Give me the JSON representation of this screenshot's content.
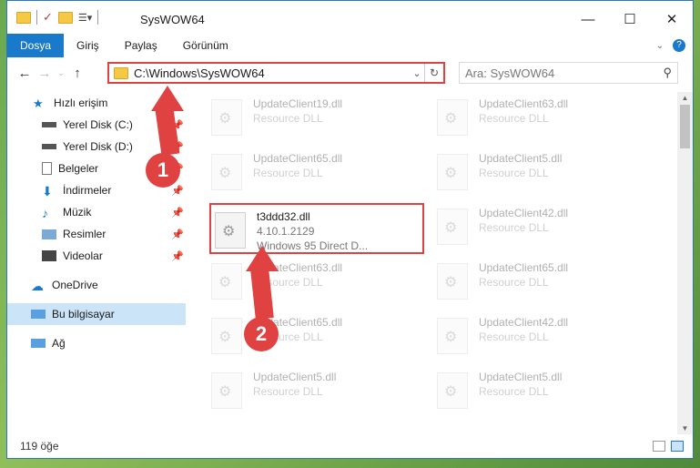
{
  "window": {
    "title": "SysWOW64"
  },
  "ribbon": {
    "tabs": [
      "Dosya",
      "Giriş",
      "Paylaş",
      "Görünüm"
    ],
    "help": "?"
  },
  "address": {
    "path": "C:\\Windows\\SysWOW64",
    "search_placeholder": "Ara: SysWOW64"
  },
  "nav": {
    "items": [
      {
        "label": "Hızlı erişim",
        "icon": "star-icon",
        "pinned": false
      },
      {
        "label": "Yerel Disk (C:)",
        "icon": "drive-icon",
        "pinned": true
      },
      {
        "label": "Yerel Disk (D:)",
        "icon": "drive-icon",
        "pinned": true
      },
      {
        "label": "Belgeler",
        "icon": "document-icon",
        "pinned": true
      },
      {
        "label": "İndirmeler",
        "icon": "download-icon",
        "pinned": true
      },
      {
        "label": "Müzik",
        "icon": "music-icon",
        "pinned": true
      },
      {
        "label": "Resimler",
        "icon": "pictures-icon",
        "pinned": true
      },
      {
        "label": "Videolar",
        "icon": "video-icon",
        "pinned": true
      },
      {
        "label": "OneDrive",
        "icon": "cloud-icon",
        "pinned": false
      },
      {
        "label": "Bu bilgisayar",
        "icon": "computer-icon",
        "pinned": false
      },
      {
        "label": "Ağ",
        "icon": "network-icon",
        "pinned": false
      }
    ]
  },
  "files": [
    {
      "name": "UpdateClient19.dll",
      "type": "Resource DLL"
    },
    {
      "name": "UpdateClient63.dll",
      "type": "Resource DLL"
    },
    {
      "name": "UpdateClient65.dll",
      "type": "Resource DLL"
    },
    {
      "name": "UpdateClient5.dll",
      "type": "Resource DLL"
    },
    {
      "name": "t3ddd32.dll",
      "type": "4.10.1.2129",
      "desc": "Windows 95 Direct D..."
    },
    {
      "name": "UpdateClient42.dll",
      "type": "Resource DLL"
    },
    {
      "name": "UpdateClient63.dll",
      "type": "Resource DLL"
    },
    {
      "name": "UpdateClient65.dll",
      "type": "Resource DLL"
    },
    {
      "name": "UpdateClient65.dll",
      "type": "Resource DLL"
    },
    {
      "name": "UpdateClient42.dll",
      "type": "Resource DLL"
    },
    {
      "name": "UpdateClient5.dll",
      "type": "Resource DLL"
    },
    {
      "name": "UpdateClient5.dll",
      "type": "Resource DLL"
    }
  ],
  "status": {
    "count": "119 öğe"
  },
  "annotations": {
    "step1": "1",
    "step2": "2",
    "color": "#e04141"
  }
}
